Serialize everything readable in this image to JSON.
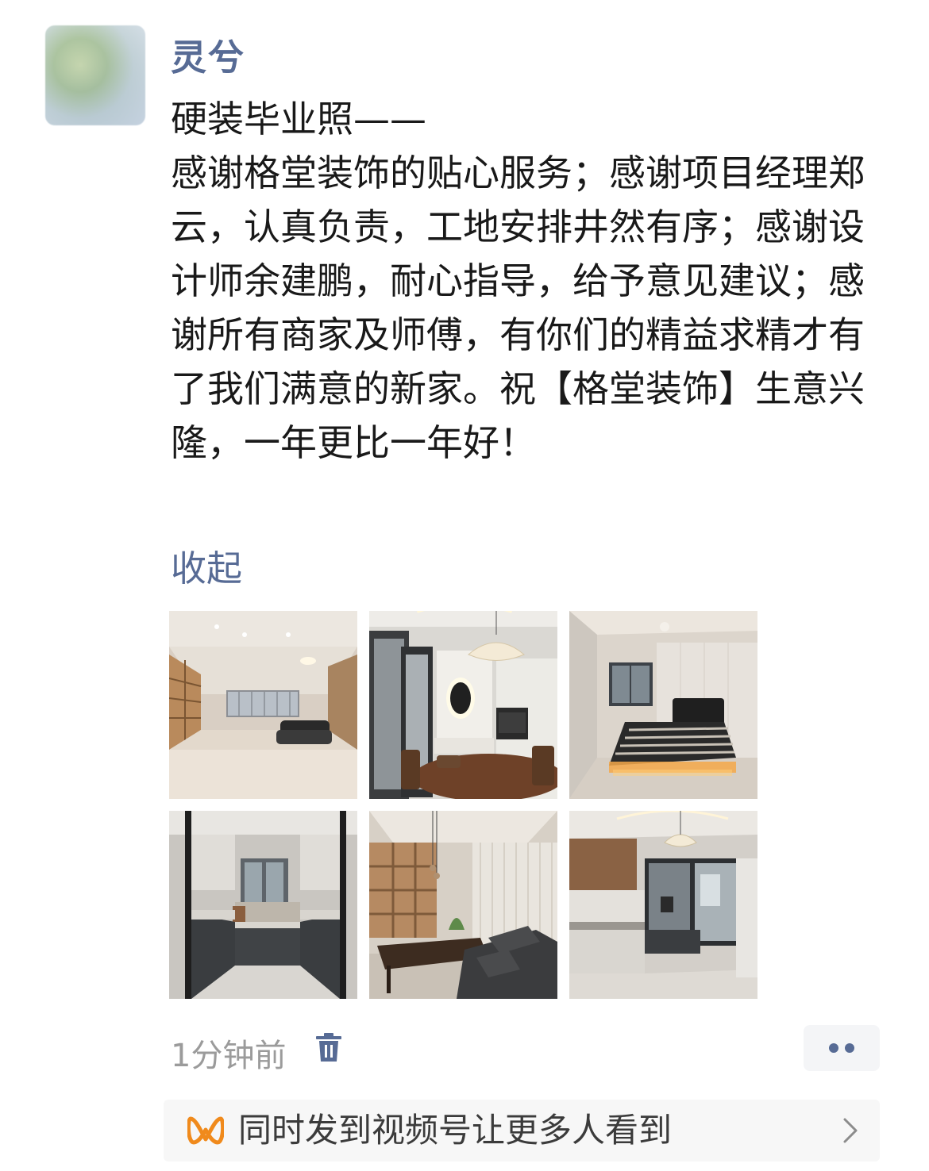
{
  "post": {
    "author": "灵兮",
    "text": "硬装毕业照——\n感谢格堂装饰的贴心服务；感谢项目经理郑云，认真负责，工地安排井然有序；感谢设计师余建鹏，耐心指导，给予意见建议；感谢所有商家及师傅，有你们的精益求精才有了我们满意的新家。祝【格堂装饰】生意兴隆，一年更比一年好！",
    "collapse_label": "收起",
    "timestamp": "1分钟前",
    "photos_count": 6
  },
  "channels_bar": {
    "label": "同时发到视频号让更多人看到"
  },
  "icons": {
    "delete": "trash-icon",
    "more": "more-dots-icon",
    "channels": "channels-logo-icon",
    "chevron": "chevron-right-icon"
  },
  "colors": {
    "link": "#576b95",
    "text": "#191919",
    "muted": "#9b9b9b",
    "channels_orange": "#f08a1c"
  }
}
